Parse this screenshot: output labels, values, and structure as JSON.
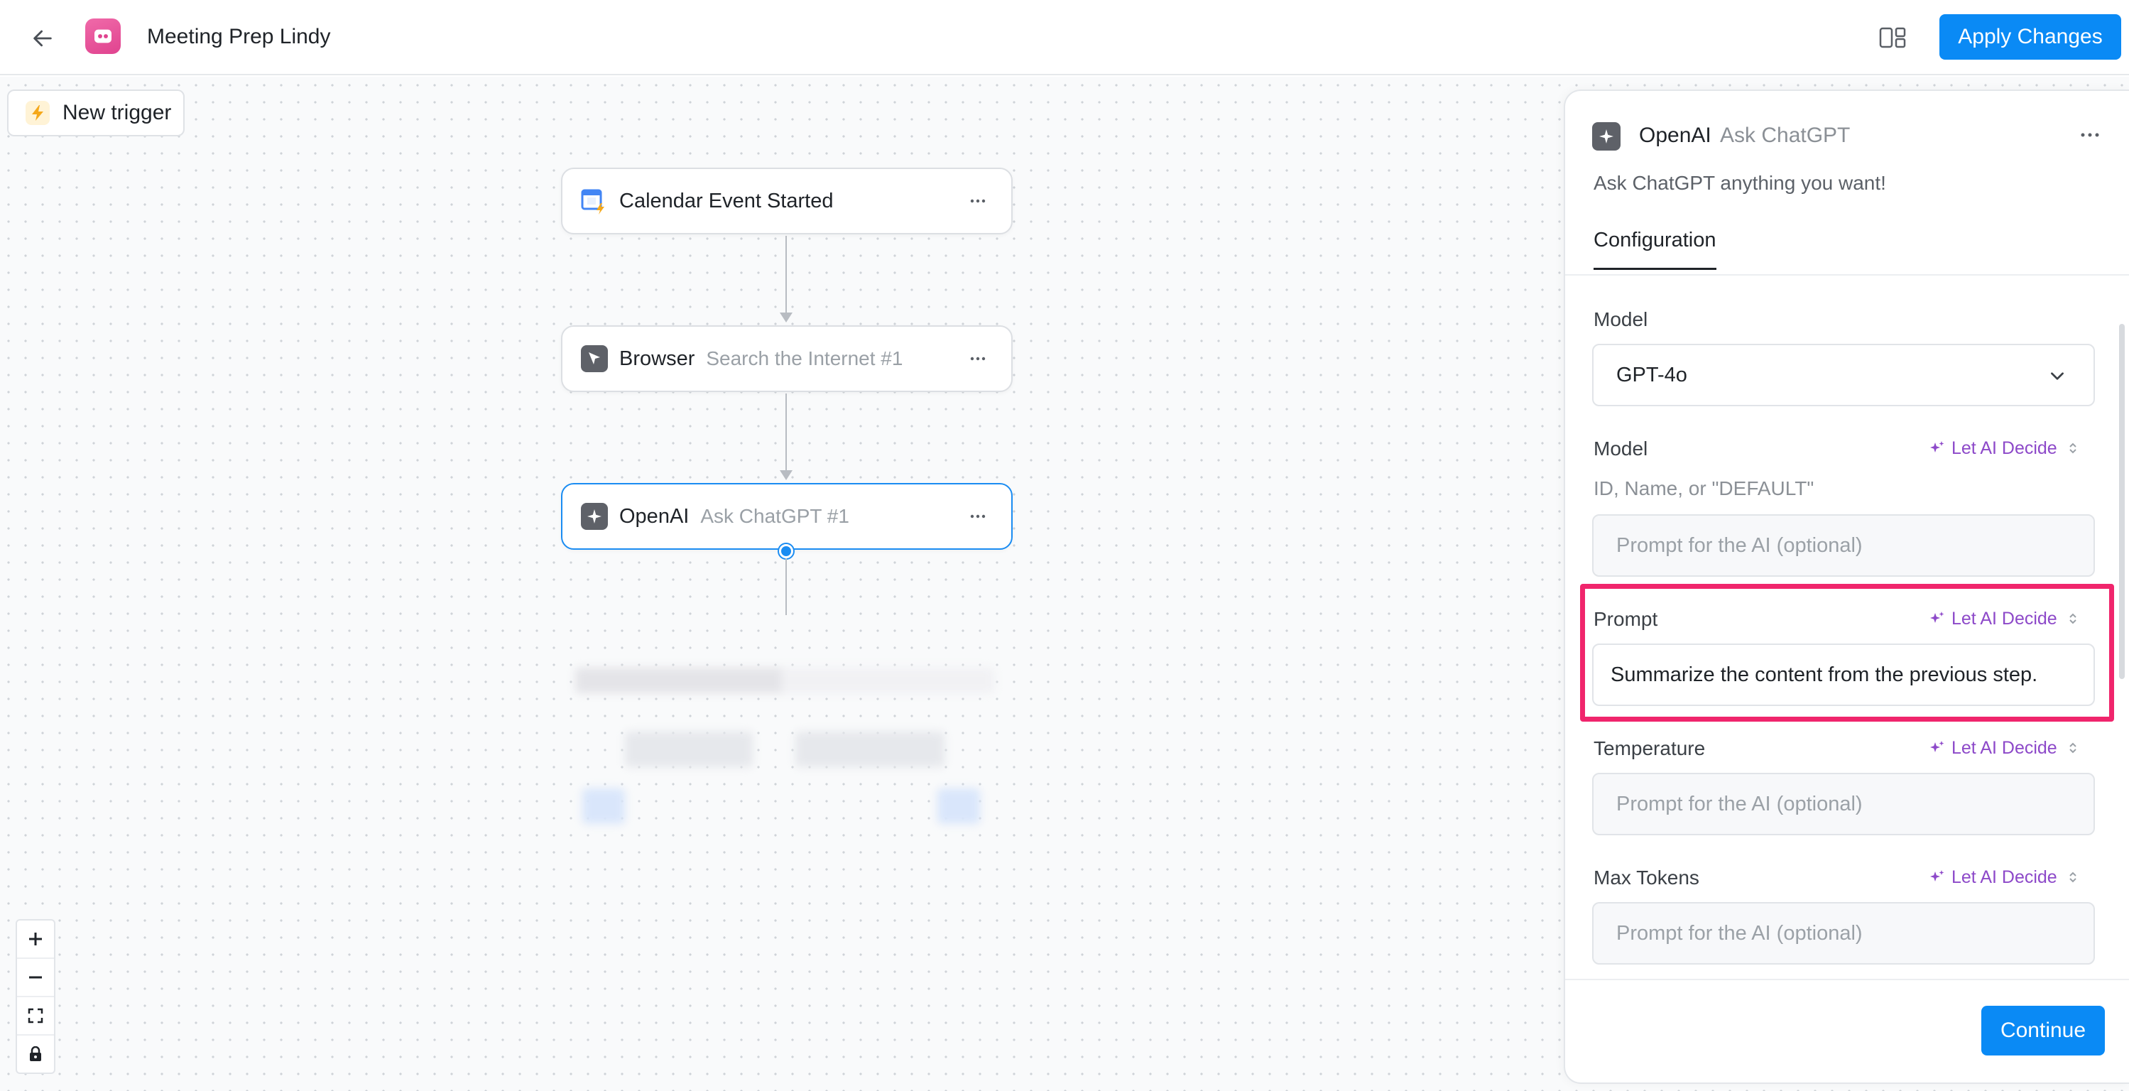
{
  "header": {
    "title": "Meeting Prep Lindy",
    "apply_label": "Apply Changes"
  },
  "canvas": {
    "new_trigger_label": "New trigger",
    "nodes": [
      {
        "name": "Calendar Event Started",
        "subtitle": ""
      },
      {
        "name": "Browser",
        "subtitle": "Search the Internet #1"
      },
      {
        "name": "OpenAI",
        "subtitle": "Ask ChatGPT #1"
      }
    ]
  },
  "panel": {
    "app_name": "OpenAI",
    "action_name": "Ask ChatGPT",
    "description": "Ask ChatGPT anything you want!",
    "tab": "Configuration",
    "model_select": {
      "label": "Model",
      "value": "GPT-4o"
    },
    "model_field": {
      "label": "Model",
      "hint": "ID, Name, or \"DEFAULT\"",
      "placeholder": "Prompt for the AI (optional)"
    },
    "prompt_field": {
      "label": "Prompt",
      "value": "Summarize the content from the previous step."
    },
    "temperature_field": {
      "label": "Temperature",
      "placeholder": "Prompt for the AI (optional)"
    },
    "max_tokens_field": {
      "label": "Max Tokens",
      "placeholder": "Prompt for the AI (optional)"
    },
    "let_ai_label": "Let AI Decide",
    "continue_label": "Continue"
  },
  "colors": {
    "accent": "#0a8af5",
    "ai_purple": "#8d49c9",
    "highlight": "#f0256c",
    "logo_pink": "#e0438f"
  },
  "icons": [
    "back-arrow-icon",
    "app-logo-icon",
    "layout-icon",
    "bolt-icon",
    "google-calendar-icon",
    "browser-icon",
    "openai-sparkle-icon",
    "more-icon",
    "chevron-down-icon",
    "ai-sparkle-icon",
    "sort-icon",
    "plus-icon",
    "minus-icon",
    "fit-view-icon",
    "lock-icon"
  ]
}
